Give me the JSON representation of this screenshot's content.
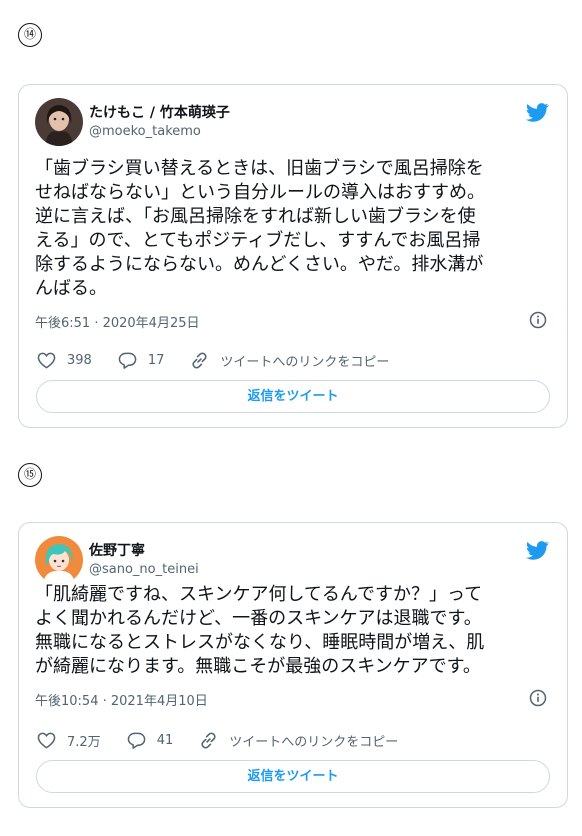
{
  "colors": {
    "accent": "#1d9bf0",
    "text": "#0f1419",
    "muted": "#536471",
    "border": "#cfd9de"
  },
  "tweets": [
    {
      "number": "⑭",
      "display_name": "たけもこ / 竹本萌瑛子",
      "handle": "@moeko_takemo",
      "text": "「歯ブラシ買い替えるときは、旧歯ブラシで風呂掃除を\nせねばならない」という自分ルールの導入はおすすめ。\n逆に言えば、「お風呂掃除をすれば新しい歯ブラシを使\nえる」ので、とてもポジティブだし、すすんでお風呂掃\n除するようにならない。めんどくさい。やだ。排水溝が\nんばる。",
      "timestamp": "午後6:51 · 2020年4月25日",
      "likes": "398",
      "replies": "17",
      "copy_link": "ツイートへのリンクをコピー",
      "reply_button": "返信をツイート"
    },
    {
      "number": "⑮",
      "display_name": "佐野丁寧",
      "handle": "@sano_no_teinei",
      "text": "「肌綺麗ですね、スキンケア何してるんですか？」って\nよく聞かれるんだけど、一番のスキンケアは退職です。\n無職になるとストレスがなくなり、睡眠時間が増え、肌\nが綺麗になります。無職こそが最強のスキンケアです。",
      "timestamp": "午後10:54 · 2021年4月10日",
      "likes": "7.2万",
      "replies": "41",
      "copy_link": "ツイートへのリンクをコピー",
      "reply_button": "返信をツイート"
    }
  ]
}
